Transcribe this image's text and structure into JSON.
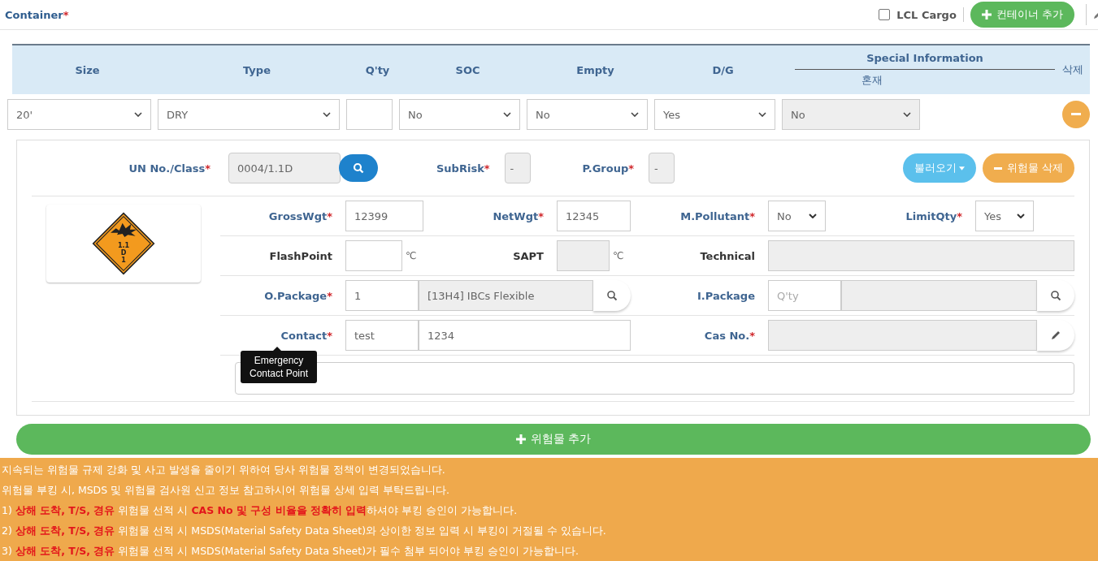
{
  "section": {
    "title": "Container",
    "mark": "*"
  },
  "lcl_cargo": {
    "label": "LCL Cargo",
    "checked": false
  },
  "add_container_button": {
    "label": "컨테이너 추가"
  },
  "table": {
    "columns": [
      "Size",
      "Type",
      "Q'ty",
      "SOC",
      "Empty",
      "D/G"
    ],
    "special_information": {
      "title": "Special Information",
      "subcolumn": "혼재"
    },
    "delete_column": "삭제",
    "rows": [
      {
        "cells": [
          {
            "kind": "select",
            "value": "20'",
            "disabled": false
          },
          {
            "kind": "select",
            "value": "DRY",
            "disabled": false
          },
          {
            "kind": "input",
            "disabled": false
          },
          {
            "kind": "select",
            "value": "No",
            "disabled": false
          },
          {
            "kind": "select",
            "value": "No",
            "disabled": false
          },
          {
            "kind": "select",
            "value": "Yes",
            "disabled": false
          },
          {
            "kind": "select",
            "value": "No",
            "disabled": true
          }
        ]
      }
    ]
  },
  "dangerous_goods": {
    "header": [
      {
        "kind": "search-field",
        "label": "UN No./Class",
        "mark": "*",
        "value": "0004/1.1D"
      },
      {
        "kind": "field",
        "label": "SubRisk",
        "mark": "*",
        "value": "-"
      },
      {
        "kind": "field",
        "label": "P.Group",
        "mark": "*",
        "value": "-"
      }
    ],
    "load_button": "불러오기",
    "delete_button": "위험물 삭제",
    "placard": [
      "1.1",
      "D",
      "1"
    ],
    "rows": [
      {
        "pairs": [
          {
            "label": "GrossWgt",
            "mark": "*",
            "accent": true,
            "fields": [
              {
                "kind": "input",
                "value": "12399",
                "disabled": false
              }
            ]
          },
          {
            "label": "NetWgt",
            "mark": "*",
            "accent": true,
            "fields": [
              {
                "kind": "input",
                "value": "12345",
                "disabled": false
              }
            ]
          },
          {
            "label": "M.Pollutant",
            "mark": "*",
            "accent": true,
            "fields": [
              {
                "kind": "select",
                "value": "No",
                "disabled": false
              }
            ]
          },
          {
            "label": "LimitQty",
            "mark": "*",
            "accent": true,
            "fields": [
              {
                "kind": "select",
                "value": "Yes",
                "disabled": false
              }
            ]
          }
        ]
      },
      {
        "pairs": [
          {
            "label": "FlashPoint",
            "accent": false,
            "fields": [
              {
                "kind": "input",
                "disabled": false
              },
              {
                "kind": "unit",
                "text": "℃"
              }
            ]
          },
          {
            "label": "SAPT",
            "accent": false,
            "fields": [
              {
                "kind": "input",
                "disabled": true
              },
              {
                "kind": "unit",
                "text": "℃"
              }
            ]
          },
          {
            "label": "Technical",
            "accent": false,
            "fields": [
              {
                "kind": "input",
                "disabled": true
              }
            ]
          }
        ]
      },
      {
        "pairs": [
          {
            "label": "O.Package",
            "mark": "*",
            "accent": true,
            "fields": [
              {
                "kind": "input",
                "value": "1",
                "disabled": false
              },
              {
                "kind": "input",
                "value": "[13H4] IBCs Flexible",
                "disabled": true
              },
              {
                "kind": "search-button"
              }
            ]
          },
          {
            "label": "I.Package",
            "accent": true,
            "fields": [
              {
                "kind": "input",
                "placeholder": "Q'ty",
                "disabled": false
              },
              {
                "kind": "input",
                "disabled": true
              },
              {
                "kind": "search-button"
              }
            ]
          }
        ]
      },
      {
        "pairs": [
          {
            "label": "Contact",
            "mark": "*",
            "accent": true,
            "fields": [
              {
                "kind": "input",
                "value": "test",
                "disabled": false
              },
              {
                "kind": "input",
                "value": "1234",
                "disabled": false
              }
            ]
          },
          {
            "label": "Cas No.",
            "mark": "*",
            "accent": true,
            "fields": [
              {
                "kind": "input",
                "disabled": true
              },
              {
                "kind": "edit-button"
              }
            ]
          }
        ]
      }
    ],
    "emergency_contact": {
      "tooltip": "Emergency Contact Point"
    }
  },
  "add_dg_button": "위험물 추가",
  "notice": [
    "지속되는 위험물 규제 강화 및 사고 발생을 줄이기 위하여 당사 위험물 정책이 변경되었습니다.",
    "위험물 부킹 시, MSDS 및 위험물 검사원 신고 정보 참고하시어 위험물 상세 입력 부탁드립니다.",
    "1) **상해 도착, T/S, 경유** 위험물 선적 시 **CAS No 및 구성 비율을 정확히 입력**하셔야 부킹 승인이 가능합니다.",
    "2) **상해 도착, T/S, 경유** 위험물 선적 시 MSDS(Material Safety Data Sheet)와 상이한 정보 입력 시 부킹이 거절될 수 있습니다.",
    "3) **상해 도착, T/S, 경유** 위험물 선적 시 MSDS(Material Safety Data Sheet)가 필수 첨부 되어야 부킹 승인이 가능합니다."
  ]
}
